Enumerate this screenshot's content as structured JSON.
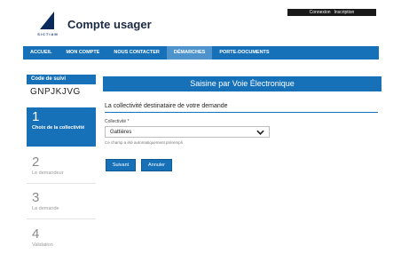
{
  "header": {
    "logo_text": "SICTIAM",
    "title": "Compte usager",
    "auth_connexion": "Connexion",
    "auth_inscription": "Inscription"
  },
  "nav": {
    "items": [
      {
        "label": "Accueil",
        "active": false
      },
      {
        "label": "Mon compte",
        "active": false
      },
      {
        "label": "Nous contacter",
        "active": false
      },
      {
        "label": "Démarches",
        "active": true
      },
      {
        "label": "Porte-documents",
        "active": false
      }
    ]
  },
  "sidebar": {
    "code_label": "Code de suivi",
    "code_value": "GNPJKJVG",
    "steps": [
      {
        "num": "1",
        "label": "Choix de la collectivité"
      },
      {
        "num": "2",
        "label": "Le demandeur"
      },
      {
        "num": "3",
        "label": "La demande"
      },
      {
        "num": "4",
        "label": "Validation"
      }
    ]
  },
  "main": {
    "banner": "Saisine par Voie Électronique",
    "section_title": "La collectivité destinataire de votre demande",
    "field_label": "Collectivité *",
    "select_value": "Gattières",
    "help_text": "Ce champ a été automatiquement prérempli",
    "next_button": "Suivant",
    "cancel_button": "Annuler"
  },
  "colors": {
    "primary": "#1771b8",
    "nav_active": "#4f93cd",
    "logo": "#0b2a5c"
  }
}
